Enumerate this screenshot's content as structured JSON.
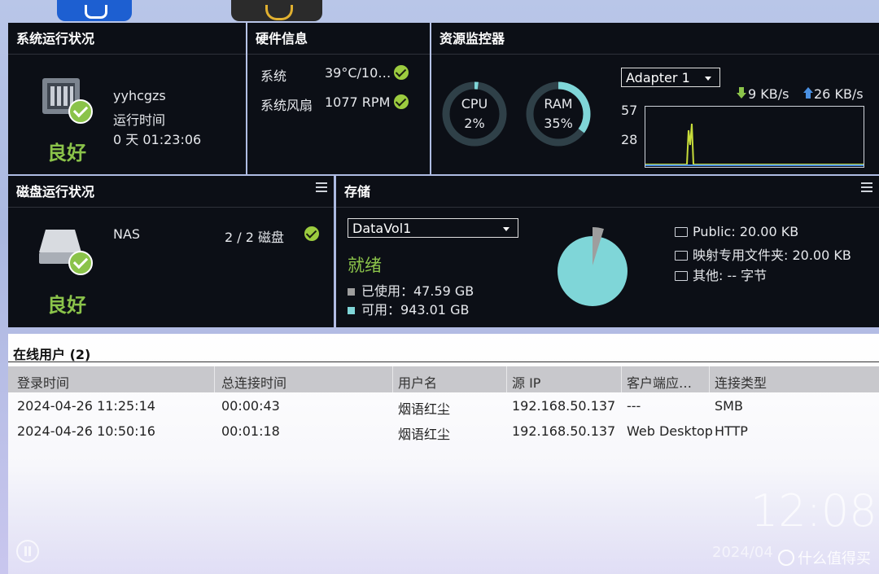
{
  "system_status": {
    "title": "系统运行状况",
    "hostname": "yyhcgzs",
    "uptime_label": "运行时间",
    "uptime_value": "0 天 01:23:06",
    "health": "良好"
  },
  "hardware": {
    "title": "硬件信息",
    "rows": [
      {
        "label": "系统",
        "value": "39°C/10…"
      },
      {
        "label": "系统风扇",
        "value": "1077 RPM"
      }
    ]
  },
  "resource_monitor": {
    "title": "资源监控器",
    "cpu": {
      "label": "CPU",
      "value": "2%",
      "fraction": 0.02
    },
    "ram": {
      "label": "RAM",
      "value": "35%",
      "fraction": 0.35
    },
    "adapter_select": "Adapter 1",
    "download": "9 KB/s",
    "upload": "26 KB/s",
    "y_ticks": [
      "57",
      "28"
    ]
  },
  "disk_status": {
    "title": "磁盘运行状况",
    "device": "NAS",
    "disks": "2 / 2 磁盘",
    "health": "良好"
  },
  "storage": {
    "title": "存储",
    "volume_select": "DataVol1",
    "state": "就绪",
    "used_label": "已使用：47.59 GB",
    "free_label": "可用：943.01 GB",
    "used_gb": 47.59,
    "free_gb": 943.01,
    "folders": [
      "Public: 20.00 KB",
      "映射专用文件夹: 20.00 KB",
      "其他: -- 字节"
    ],
    "colors": {
      "used": "#9e9e9e",
      "free": "#7fd6d8"
    }
  },
  "online_users": {
    "title": "在线用户 (2)",
    "columns": [
      "登录时间",
      "总连接时间",
      "用户名",
      "源 IP",
      "客户端应…",
      "连接类型"
    ],
    "rows": [
      [
        "2024-04-26 11:25:14",
        "00:00:43",
        "烟语红尘",
        "192.168.50.137",
        "---",
        "SMB"
      ],
      [
        "2024-04-26 10:50:16",
        "00:01:18",
        "烟语红尘",
        "192.168.50.137",
        "Web Desktop",
        "HTTP"
      ]
    ]
  },
  "desktop": {
    "clock": "12:08",
    "date": "2024/04",
    "watermark": "什么值得买"
  }
}
